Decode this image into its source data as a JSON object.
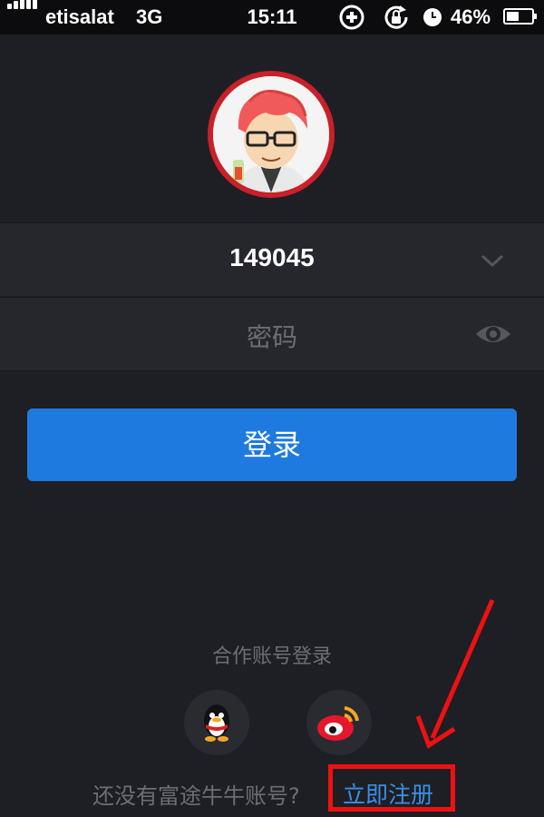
{
  "status_bar": {
    "carrier": "etisalat",
    "network": "3G",
    "time": "15:11",
    "battery_percent": "46%",
    "icons": [
      "signal-icon",
      "plus-circle-icon",
      "rotation-lock-icon",
      "clock-icon",
      "battery-charging-icon"
    ]
  },
  "login": {
    "username_value": "149045",
    "password_placeholder": "密码",
    "login_button": "登录"
  },
  "partner": {
    "label": "合作账号登录",
    "providers": [
      "qq-icon",
      "weibo-icon"
    ]
  },
  "register": {
    "hint": "还没有富途牛牛账号?",
    "link": "立即注册"
  },
  "colors": {
    "background": "#1e1f24",
    "accent": "#1f7ae0",
    "link": "#3a8fe8",
    "annotation": "#ee1111"
  }
}
